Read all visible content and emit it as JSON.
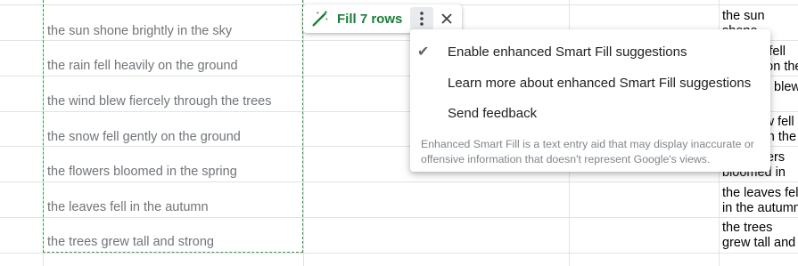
{
  "sheet": {
    "column_a_cells": [
      "the sun shone brightly in the sky",
      "the rain fell heavily on the ground",
      "the wind blew fiercely through the trees",
      "the snow fell gently on the ground",
      "the flowers bloomed in the spring",
      "the leaves fell in the autumn",
      "the trees grew tall and strong"
    ],
    "right_column_cells": [
      "the sun shone brightly in the sky",
      "the rain fell heavily on the ground",
      "the wind blew fiercely through the trees",
      "the snow fell gently on the ground",
      "the flowers bloomed in the spring",
      "the leaves fell in the autumn",
      "the trees grew tall and strong"
    ]
  },
  "smart_fill_chip": {
    "fill_label": "Fill 7 rows",
    "wand_icon": "magic-wand-icon",
    "more_icon": "more-vert-icon",
    "close_icon": "close-icon",
    "accent_color": "#188038"
  },
  "menu": {
    "items": [
      {
        "label": "Enable enhanced Smart Fill suggestions",
        "checked": true
      },
      {
        "label": "Learn more about enhanced Smart Fill suggestions",
        "checked": false
      },
      {
        "label": "Send feedback",
        "checked": false
      }
    ],
    "check_glyph": "✔",
    "disclaimer": "Enhanced Smart Fill is a text entry aid that may display inaccurate or offensive information that doesn't represent Google's views."
  }
}
